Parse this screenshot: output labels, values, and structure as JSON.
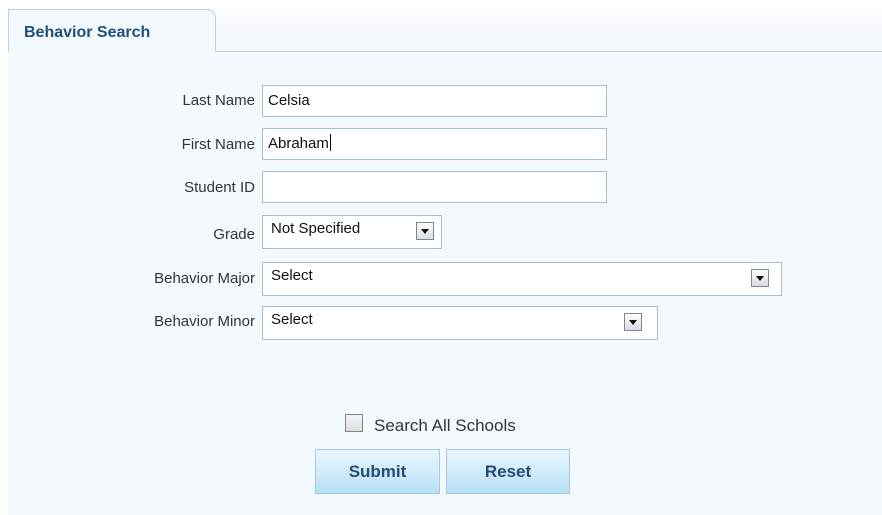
{
  "tab": {
    "label": "Behavior Search"
  },
  "form": {
    "last_name": {
      "label": "Last Name",
      "value": "Celsia"
    },
    "first_name": {
      "label": "First Name",
      "value": "Abraham"
    },
    "student_id": {
      "label": "Student ID",
      "value": ""
    },
    "grade": {
      "label": "Grade",
      "selected": "Not Specified"
    },
    "behavior_major": {
      "label": "Behavior Major",
      "selected": "Select"
    },
    "behavior_minor": {
      "label": "Behavior Minor",
      "selected": "Select"
    },
    "search_all_schools": {
      "label": "Search All Schools",
      "checked": false
    }
  },
  "buttons": {
    "submit": "Submit",
    "reset": "Reset"
  },
  "colors": {
    "tab_text": "#1e4f7a",
    "button_text": "#214c74",
    "panel_bg": "#f4f9fd"
  }
}
